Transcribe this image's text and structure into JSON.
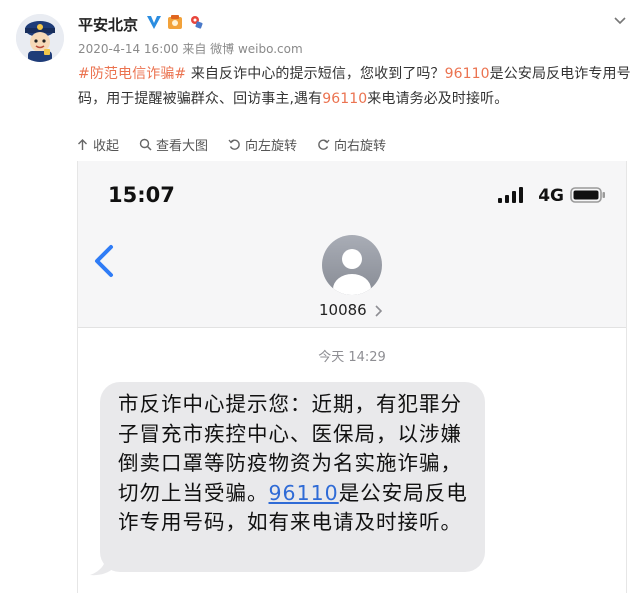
{
  "post": {
    "author": "平安北京",
    "meta": "2020-4-14 16:00 来自 微博 weibo.com",
    "hashtag": "#防范电信诈骗#",
    "text_1": " 来自反诈中心的提示短信，您收到了吗？",
    "number_1": "96110",
    "text_2": "是公安局反电诈专用号码，用于提醒被骗群众、回访事主,遇有",
    "number_2": "96110",
    "text_3": "来电请务必及时接听。",
    "toolbar": {
      "collapse": "收起",
      "view_large": "查看大图",
      "rotate_left": "向左旋转",
      "rotate_right": "向右旋转"
    }
  },
  "phone": {
    "time": "15:07",
    "network": "4G",
    "contact": "10086",
    "date": "今天 14:29",
    "message_1": "市反诈中心提示您：近期，有犯罪分子冒充市疾控中心、医保局，以涉嫌倒卖口罩等防疫物资为名实施诈骗，切勿上当受骗。",
    "message_link": "96110",
    "message_2": "是公安局反电诈专用号码，如有来电请及时接听。"
  },
  "colors": {
    "accent": "#eb7350",
    "link": "#2f6bd6",
    "bubble": "#e9e9eb"
  },
  "icons": [
    "police-mascot-avatar",
    "verified-v-icon",
    "badge-icon",
    "chevron-down-icon",
    "collapse-arrow-icon",
    "search-icon",
    "rotate-left-icon",
    "rotate-right-icon",
    "signal-icon",
    "battery-icon",
    "back-chevron-icon",
    "contact-avatar-icon"
  ]
}
